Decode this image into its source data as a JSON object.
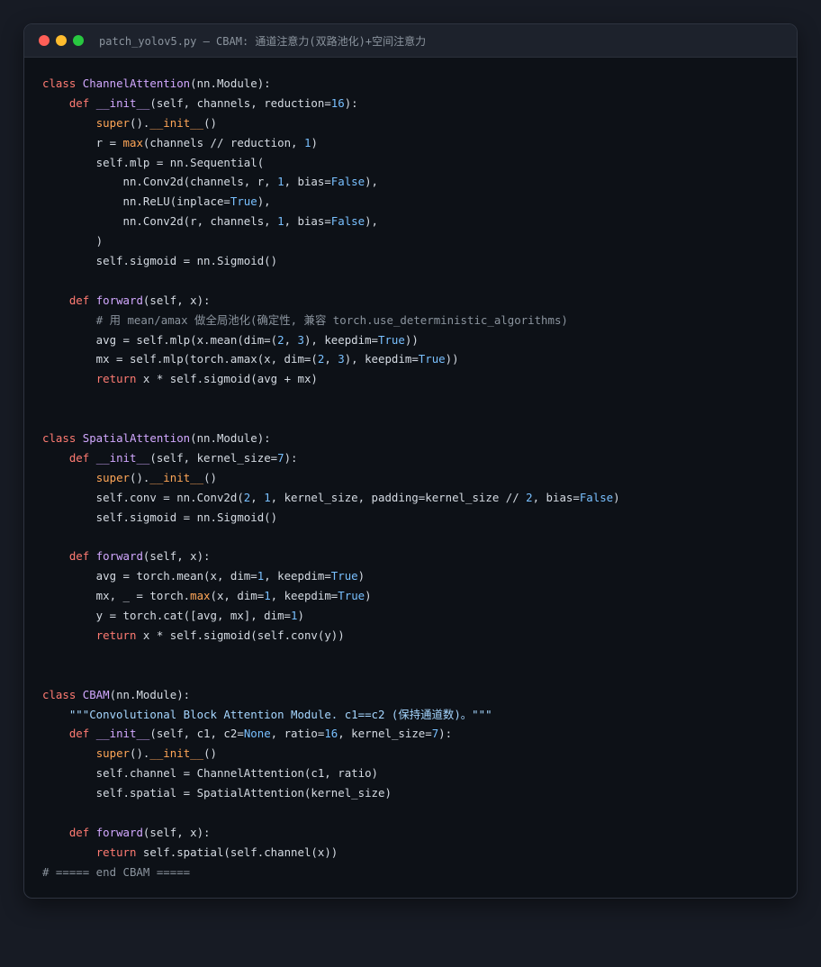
{
  "window": {
    "title": "patch_yolov5.py — CBAM: 通道注意力(双路池化)+空间注意力",
    "controls": [
      "close",
      "minimize",
      "maximize"
    ],
    "colors": {
      "close": "#ff5f57",
      "minimize": "#febc2e",
      "maximize": "#28c840",
      "keyword": "#ff7b72",
      "class_name": "#d2a8ff",
      "number": "#79c0ff",
      "builtin": "#ffa657",
      "comment": "#8b949e",
      "string": "#a5d6ff",
      "text": "#d5dbe3",
      "background": "#0d1117"
    }
  },
  "code_lines": [
    [
      [
        "kw",
        "class "
      ],
      [
        "cls",
        "ChannelAttention"
      ],
      [
        "t",
        "(nn.Module):"
      ]
    ],
    [
      [
        "t",
        "    "
      ],
      [
        "kw",
        "def "
      ],
      [
        "fn",
        "__init__"
      ],
      [
        "t",
        "(self, channels, reduction="
      ],
      [
        "num",
        "16"
      ],
      [
        "t",
        "):"
      ]
    ],
    [
      [
        "t",
        "        "
      ],
      [
        "bi",
        "super"
      ],
      [
        "t",
        "()."
      ],
      [
        "bi",
        "__init__"
      ],
      [
        "t",
        "()"
      ]
    ],
    [
      [
        "t",
        "        r = "
      ],
      [
        "bi",
        "max"
      ],
      [
        "t",
        "(channels // reduction, "
      ],
      [
        "num",
        "1"
      ],
      [
        "t",
        ")"
      ]
    ],
    [
      [
        "t",
        "        self.mlp = nn.Sequential("
      ]
    ],
    [
      [
        "t",
        "            nn.Conv2d(channels, r, "
      ],
      [
        "num",
        "1"
      ],
      [
        "t",
        ", bias="
      ],
      [
        "bool",
        "False"
      ],
      [
        "t",
        "),"
      ]
    ],
    [
      [
        "t",
        "            nn.ReLU(inplace="
      ],
      [
        "bool",
        "True"
      ],
      [
        "t",
        "),"
      ]
    ],
    [
      [
        "t",
        "            nn.Conv2d(r, channels, "
      ],
      [
        "num",
        "1"
      ],
      [
        "t",
        ", bias="
      ],
      [
        "bool",
        "False"
      ],
      [
        "t",
        "),"
      ]
    ],
    [
      [
        "t",
        "        )"
      ]
    ],
    [
      [
        "t",
        "        self.sigmoid = nn.Sigmoid()"
      ]
    ],
    [],
    [
      [
        "t",
        "    "
      ],
      [
        "kw",
        "def "
      ],
      [
        "fn",
        "forward"
      ],
      [
        "t",
        "(self, x):"
      ]
    ],
    [
      [
        "t",
        "        "
      ],
      [
        "cm",
        "# 用 mean/amax 做全局池化(确定性, 兼容 torch.use_deterministic_algorithms)"
      ]
    ],
    [
      [
        "t",
        "        avg = self.mlp(x.mean(dim=("
      ],
      [
        "num",
        "2"
      ],
      [
        "t",
        ", "
      ],
      [
        "num",
        "3"
      ],
      [
        "t",
        "), keepdim="
      ],
      [
        "bool",
        "True"
      ],
      [
        "t",
        "))"
      ]
    ],
    [
      [
        "t",
        "        mx = self.mlp(torch.amax(x, dim=("
      ],
      [
        "num",
        "2"
      ],
      [
        "t",
        ", "
      ],
      [
        "num",
        "3"
      ],
      [
        "t",
        "), keepdim="
      ],
      [
        "bool",
        "True"
      ],
      [
        "t",
        "))"
      ]
    ],
    [
      [
        "t",
        "        "
      ],
      [
        "kw",
        "return"
      ],
      [
        "t",
        " x * self.sigmoid(avg + mx)"
      ]
    ],
    [],
    [],
    [
      [
        "kw",
        "class "
      ],
      [
        "cls",
        "SpatialAttention"
      ],
      [
        "t",
        "(nn.Module):"
      ]
    ],
    [
      [
        "t",
        "    "
      ],
      [
        "kw",
        "def "
      ],
      [
        "fn",
        "__init__"
      ],
      [
        "t",
        "(self, kernel_size="
      ],
      [
        "num",
        "7"
      ],
      [
        "t",
        "):"
      ]
    ],
    [
      [
        "t",
        "        "
      ],
      [
        "bi",
        "super"
      ],
      [
        "t",
        "()."
      ],
      [
        "bi",
        "__init__"
      ],
      [
        "t",
        "()"
      ]
    ],
    [
      [
        "t",
        "        self.conv = nn.Conv2d("
      ],
      [
        "num",
        "2"
      ],
      [
        "t",
        ", "
      ],
      [
        "num",
        "1"
      ],
      [
        "t",
        ", kernel_size, padding=kernel_size // "
      ],
      [
        "num",
        "2"
      ],
      [
        "t",
        ", bias="
      ],
      [
        "bool",
        "False"
      ],
      [
        "t",
        ")"
      ]
    ],
    [
      [
        "t",
        "        self.sigmoid = nn.Sigmoid()"
      ]
    ],
    [],
    [
      [
        "t",
        "    "
      ],
      [
        "kw",
        "def "
      ],
      [
        "fn",
        "forward"
      ],
      [
        "t",
        "(self, x):"
      ]
    ],
    [
      [
        "t",
        "        avg = torch.mean(x, dim="
      ],
      [
        "num",
        "1"
      ],
      [
        "t",
        ", keepdim="
      ],
      [
        "bool",
        "True"
      ],
      [
        "t",
        ")"
      ]
    ],
    [
      [
        "t",
        "        mx, _ = torch."
      ],
      [
        "bi",
        "max"
      ],
      [
        "t",
        "(x, dim="
      ],
      [
        "num",
        "1"
      ],
      [
        "t",
        ", keepdim="
      ],
      [
        "bool",
        "True"
      ],
      [
        "t",
        ")"
      ]
    ],
    [
      [
        "t",
        "        y = torch.cat([avg, mx], dim="
      ],
      [
        "num",
        "1"
      ],
      [
        "t",
        ")"
      ]
    ],
    [
      [
        "t",
        "        "
      ],
      [
        "kw",
        "return"
      ],
      [
        "t",
        " x * self.sigmoid(self.conv(y))"
      ]
    ],
    [],
    [],
    [
      [
        "kw",
        "class "
      ],
      [
        "cls",
        "CBAM"
      ],
      [
        "t",
        "(nn.Module):"
      ]
    ],
    [
      [
        "t",
        "    "
      ],
      [
        "str",
        "\"\"\"Convolutional Block Attention Module. c1==c2 (保持通道数)。\"\"\""
      ]
    ],
    [
      [
        "t",
        "    "
      ],
      [
        "kw",
        "def "
      ],
      [
        "fn",
        "__init__"
      ],
      [
        "t",
        "(self, c1, c2="
      ],
      [
        "bool",
        "None"
      ],
      [
        "t",
        ", ratio="
      ],
      [
        "num",
        "16"
      ],
      [
        "t",
        ", kernel_size="
      ],
      [
        "num",
        "7"
      ],
      [
        "t",
        "):"
      ]
    ],
    [
      [
        "t",
        "        "
      ],
      [
        "bi",
        "super"
      ],
      [
        "t",
        "()."
      ],
      [
        "bi",
        "__init__"
      ],
      [
        "t",
        "()"
      ]
    ],
    [
      [
        "t",
        "        self.channel = ChannelAttention(c1, ratio)"
      ]
    ],
    [
      [
        "t",
        "        self.spatial = SpatialAttention(kernel_size)"
      ]
    ],
    [],
    [
      [
        "t",
        "    "
      ],
      [
        "kw",
        "def "
      ],
      [
        "fn",
        "forward"
      ],
      [
        "t",
        "(self, x):"
      ]
    ],
    [
      [
        "t",
        "        "
      ],
      [
        "kw",
        "return"
      ],
      [
        "t",
        " self.spatial(self.channel(x))"
      ]
    ],
    [
      [
        "cm",
        "# ===== end CBAM ====="
      ]
    ]
  ]
}
